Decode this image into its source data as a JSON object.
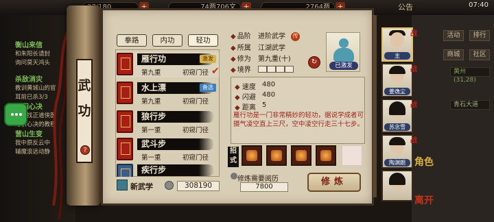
{
  "top_bar": {
    "stamina": "27/180",
    "silver": "74两706文",
    "gold": "2764两",
    "announce": "公告",
    "clock": "07:40"
  },
  "quests": [
    {
      "title": "衡山来信",
      "desc": "和朱阳长请封"
    },
    {
      "title": "",
      "desc": "询问莫天鸿头"
    },
    {
      "title": "杀敌消灾",
      "desc": "教训黄城山的官"
    },
    {
      "title": "",
      "desc": "耳前已杀3/3"
    },
    {
      "title": "引归心决",
      "desc": "前去找正道侠医"
    },
    {
      "title": "",
      "desc": "与引心决的教程"
    },
    {
      "title": "营山生变",
      "desc": "我中原反云中"
    },
    {
      "title": "",
      "desc": "辅魔浪远动静"
    }
  ],
  "right_menu": {
    "btn_activity": "活动",
    "btn_ranking": "排行",
    "btn_shop": "商城",
    "btn_guild": "社区",
    "map_info": "黄州  (31,28)",
    "waypoint": "青石大道"
  },
  "scroll": {
    "title_1": "武",
    "title_2": "功",
    "help": "?"
  },
  "tabs": [
    "拳路",
    "内功",
    "轻功"
  ],
  "skills": [
    {
      "name": "雁行功",
      "tag": "激发",
      "layer": "第九重",
      "grade": "初窥门径",
      "selected": true
    },
    {
      "name": "水上漂",
      "tag": "备选",
      "layer": "第九重",
      "grade": "初窥门径",
      "selected": false
    },
    {
      "name": "狼行步",
      "tag": "",
      "layer": "第一重",
      "grade": "初窥门径",
      "selected": false
    },
    {
      "name": "武斗步",
      "tag": "",
      "layer": "第一重",
      "grade": "初窥门径",
      "selected": false
    },
    {
      "name": "疾行步",
      "tag": "",
      "layer": "",
      "grade": "",
      "selected": false
    }
  ],
  "footer_left": {
    "new_martial": "新武学",
    "points": "308190"
  },
  "info": {
    "label_grade": "品阶",
    "value_grade": "进阶武学",
    "grade_badge": "传",
    "label_source": "所属",
    "value_source": "江湖武学",
    "label_volume": "修为",
    "value_volume": "第九重(十)",
    "label_realm": "境界",
    "portrait_caption": "已激发",
    "refresh_icon": "刷新"
  },
  "stats": [
    {
      "label": "速度",
      "value": "480"
    },
    {
      "label": "闪避",
      "value": "480"
    },
    {
      "label": "距离",
      "value": "5"
    }
  ],
  "description": "雁行功是一门非常精妙的轻功，据说学成者可摄气凌空直上三尺，空中凌空行走三十七步。",
  "moves": {
    "label": "招式"
  },
  "training": {
    "cost_label": "修炼需要阅历",
    "cost_value": "7800",
    "button": "修炼"
  },
  "heroes": [
    {
      "name": "主",
      "badge": "战"
    },
    {
      "name": "姜逸尘",
      "badge": "战"
    },
    {
      "name": "苏念雪",
      "badge": "战"
    },
    {
      "name": "陶渊朗",
      "badge": "战"
    },
    {
      "name": "",
      "badge": ""
    }
  ],
  "role_marks": [
    "角色",
    "离开"
  ],
  "colors": {
    "accent_red": "#b4331c",
    "tag_active": "#d6b24a",
    "tag_spare": "#3d7fb9",
    "desc_red": "#a0241a",
    "quest_green": "#7fbf55"
  }
}
